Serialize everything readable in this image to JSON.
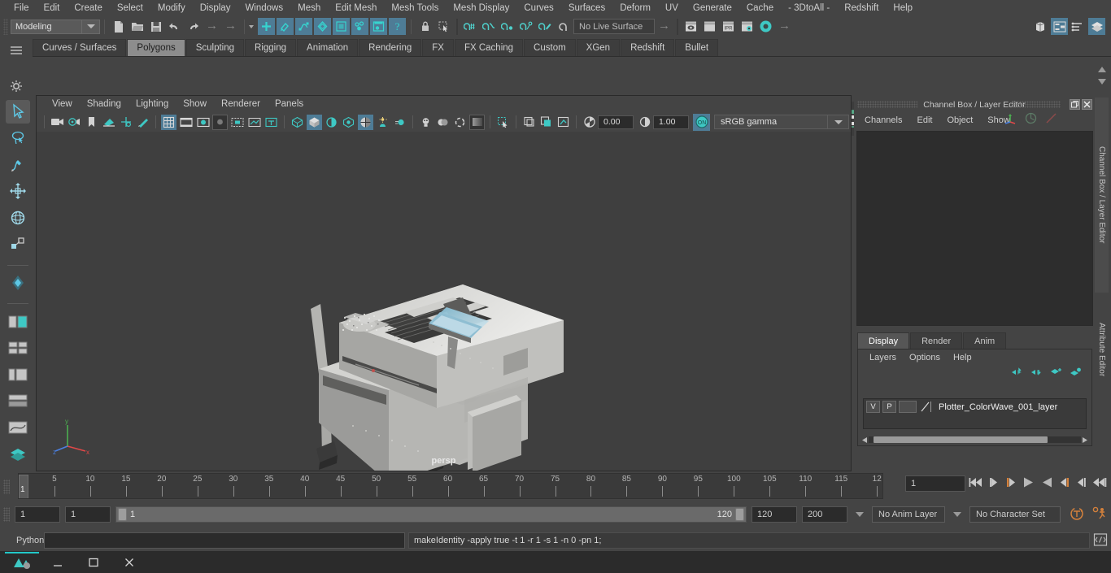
{
  "menubar": {
    "items": [
      "File",
      "Edit",
      "Create",
      "Select",
      "Modify",
      "Display",
      "Windows",
      "Mesh",
      "Edit Mesh",
      "Mesh Tools",
      "Mesh Display",
      "Curves",
      "Surfaces",
      "Deform",
      "UV",
      "Generate",
      "Cache",
      "- 3DtoAll -",
      "Redshift",
      "Help"
    ]
  },
  "statusbar": {
    "menuset": "Modeling",
    "live_surface": "No Live Surface",
    "icons": [
      "new-scene-icon",
      "open-scene-icon",
      "save-scene-icon",
      "undo-icon",
      "redo-icon",
      "select-by-hierarchy-icon",
      "select-by-object-icon",
      "select-by-component-icon",
      "lock-selection-icon",
      "marquee-select-icon",
      "snap-to-grid-icon",
      "snap-to-curve-icon",
      "snap-to-point-icon",
      "snap-to-projected-center-icon",
      "snap-to-view-plane-icon",
      "make-live-icon",
      "render-view-icon",
      "render-region-icon",
      "ipr-render-icon",
      "render-settings-icon",
      "hypershade-icon"
    ],
    "right_icons": [
      "show-hide-modeling-toolkit-icon",
      "attribute-editor-icon",
      "tool-settings-icon",
      "channel-box-layer-editor-icon"
    ]
  },
  "shelf": {
    "tabs": [
      "Curves / Surfaces",
      "Polygons",
      "Sculpting",
      "Rigging",
      "Animation",
      "Rendering",
      "FX",
      "FX Caching",
      "Custom",
      "XGen",
      "Redshift",
      "Bullet"
    ],
    "active_tab": "Polygons",
    "buttons": [
      "poly-sphere-icon",
      "poly-cube-icon",
      "poly-cylinder-icon",
      "poly-cone-icon",
      "poly-plane-icon",
      "poly-torus-icon",
      "poly-pyramid-icon",
      "poly-pipe-icon",
      "combine-icon",
      "separate-icon",
      "mirror-geometry-icon",
      "extrude-icon",
      "bevel-icon",
      "multi-cut-icon",
      "target-weld-icon",
      "connect-icon",
      "bridge-icon",
      "append-to-polygon-icon",
      "offset-edge-loop-icon",
      "insert-edge-loop-icon",
      "smooth-icon",
      "sculpt-icon",
      "crease-icon",
      "quad-draw-icon",
      "boolean-union-icon",
      "boolean-difference-icon",
      "boolean-intersection-icon",
      "reduce-icon",
      "smooth-mesh-icon",
      "cleanup-icon",
      "triangulate-icon"
    ]
  },
  "toolbox": {
    "tools": [
      "select-tool-icon",
      "lasso-select-tool-icon",
      "paint-select-tool-icon",
      "move-tool-icon",
      "rotate-tool-icon",
      "scale-tool-icon",
      "last-tool-used-icon",
      "persp-view-layout-icon",
      "two-pane-layout-icon",
      "outliner-layout-icon",
      "hypergraph-layout-icon",
      "graph-editor-layout-icon",
      "hypershade-layout-icon"
    ]
  },
  "viewport": {
    "menus": [
      "View",
      "Shading",
      "Lighting",
      "Show",
      "Renderer",
      "Panels"
    ],
    "camera_label": "persp",
    "exposure_value": "0.00",
    "gamma_value": "1.00",
    "color_space": "sRGB gamma",
    "toolbar_icons": [
      "select-camera-icon",
      "camera-attributes-icon",
      "bookmark-icon",
      "image-plane-icon",
      "2d-pan-zoom-icon",
      "grease-pencil-icon",
      "grid-toggle-icon",
      "film-gate-icon",
      "resolution-gate-icon",
      "gate-mask-icon",
      "field-chart-icon",
      "safe-action-icon",
      "title-safe-icon",
      "wireframe-icon",
      "smooth-shade-all-icon",
      "shaded-wireframe-icon",
      "use-all-lights-icon",
      "shadows-icon",
      "screen-space-ao-icon",
      "motion-blur-icon",
      "multisample-aa-icon",
      "depth-of-field-icon",
      "isolate-select-icon",
      "xray-icon",
      "xray-joints-icon",
      "xray-active-components-icon",
      "exposure-icon",
      "gamma-icon",
      "color-management-toggle-icon"
    ]
  },
  "right_panel": {
    "title": "Channel Box / Layer Editor",
    "window_controls": [
      "undock-icon",
      "close-icon"
    ],
    "channel_menus": [
      "Channels",
      "Edit",
      "Object",
      "Show"
    ],
    "header_icons": [
      "transform-channels-icon",
      "output-channels-icon",
      "shape-channels-icon"
    ],
    "layer_tabs": [
      "Display",
      "Render",
      "Anim"
    ],
    "active_layer_tab": "Display",
    "layer_menus": [
      "Layers",
      "Options",
      "Help"
    ],
    "layer_buttons": [
      "move-layer-up-icon",
      "move-layer-down-icon",
      "new-layer-icon",
      "new-layer-from-selected-icon"
    ],
    "layers": [
      {
        "visibility": "V",
        "playback": "P",
        "shading": "",
        "name": "Plotter_ColorWave_001_layer"
      }
    ],
    "side_tabs": [
      "Channel Box / Layer Editor",
      "Attribute Editor"
    ]
  },
  "timeline": {
    "tick_labels": [
      "5",
      "10",
      "15",
      "20",
      "25",
      "30",
      "35",
      "40",
      "45",
      "50",
      "55",
      "60",
      "65",
      "70",
      "75",
      "80",
      "85",
      "90",
      "95",
      "100",
      "105",
      "110",
      "115",
      "12"
    ],
    "current_frame": "1",
    "playhead_label": "1",
    "playback_controls": [
      "go-to-start-icon",
      "step-back-keyframe-icon",
      "step-back-frame-icon",
      "play-backwards-icon",
      "play-forwards-icon",
      "step-forward-frame-icon",
      "step-forward-keyframe-icon",
      "go-to-end-icon"
    ]
  },
  "range": {
    "start_field": "1",
    "end_field": "1",
    "range_start_label": "1",
    "range_end_label": "120",
    "playback_end": "120",
    "anim_end": "200",
    "anim_layer": "No Anim Layer",
    "character_set": "No Character Set",
    "right_icons": [
      "auto-key-icon",
      "animation-preferences-icon"
    ]
  },
  "command_line": {
    "language_label": "Python",
    "input_value": "",
    "result_text": "makeIdentity -apply true -t 1 -r 1 -s 1 -n 0 -pn 1;",
    "script_editor_icon": "script-editor-icon"
  },
  "taskbar": {
    "items": [
      "maya-app-icon",
      "minimize-icon",
      "maximize-icon",
      "close-icon"
    ]
  },
  "colors": {
    "accent_blue": "#4e7c96",
    "accent_teal": "#3fb4b4",
    "shelf_orange": "#d08c4e",
    "shelf_green": "#57a887",
    "panel_bg": "#444444",
    "viewport_bg": "#3f3f3f",
    "active_tab": "#8d8d8d"
  }
}
